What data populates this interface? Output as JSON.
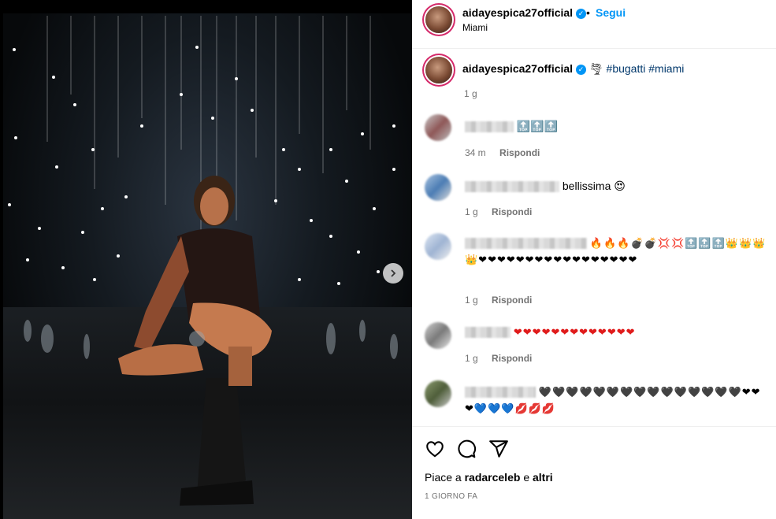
{
  "header": {
    "username": "aidayespica27official",
    "separator": "•",
    "follow_label": "Segui",
    "location": "Miami"
  },
  "caption": {
    "username": "aidayespica27official",
    "emoji": "🌪",
    "tags": "#bugatti #miami",
    "time": "1 g"
  },
  "comments": [
    {
      "text": "🔝🔝🔝",
      "time": "34 m",
      "reply": "Rispondi"
    },
    {
      "text": "bellissima 😍",
      "time": "1 g",
      "reply": "Rispondi"
    },
    {
      "text": "🔥🔥🔥💣💣💢💢🔝🔝🔝👑👑👑👑❤❤❤❤❤❤❤❤❤❤❤❤❤❤❤❤❤",
      "time": "1 g",
      "reply": "Rispondi"
    },
    {
      "text": "❤❤❤❤❤❤❤❤❤❤❤❤❤",
      "time": "1 g",
      "reply": "Rispondi"
    },
    {
      "text": "🖤🖤🖤🖤🖤🖤🖤🖤🖤🖤🖤🖤🖤🖤🖤❤❤❤💙💙💙💋💋💋",
      "time": "",
      "reply": ""
    }
  ],
  "likes": {
    "prefix": "Piace a",
    "user": "radarceleb",
    "conj": "e",
    "others": "altri"
  },
  "date": "1 GIORNO FA",
  "colors": {
    "accent": "#0095f6",
    "link": "#00376b",
    "muted": "#737373"
  },
  "icons": [
    "heart-icon",
    "comment-icon",
    "share-icon",
    "chevron-right-icon",
    "verified-icon"
  ]
}
